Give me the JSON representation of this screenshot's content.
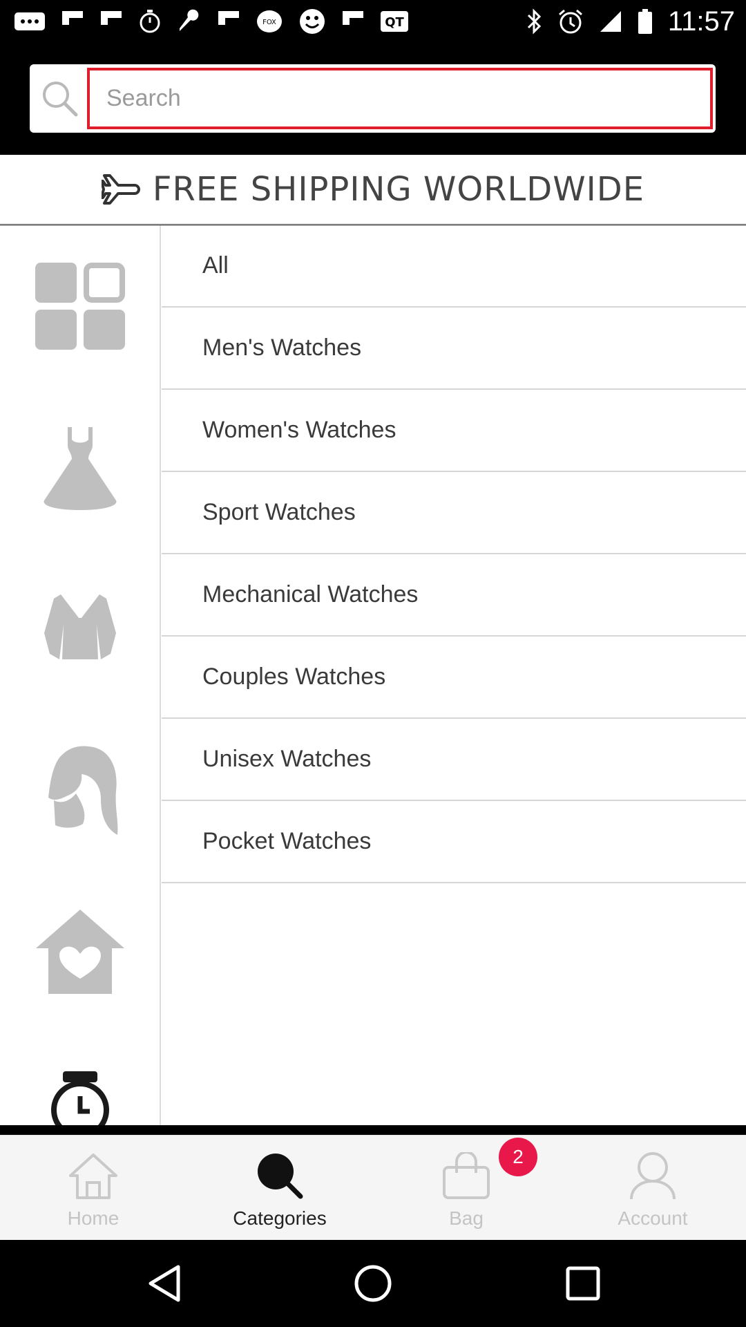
{
  "status_bar": {
    "time": "11:57",
    "icons": [
      "more-icon",
      "flipboard-icon",
      "flipboard-icon",
      "timer-icon",
      "wrench-icon",
      "flipboard-icon",
      "fox-sports-icon",
      "smiley-icon",
      "flipboard-icon",
      "qt-icon",
      "bluetooth-icon",
      "alarm-icon",
      "signal-icon",
      "battery-icon"
    ]
  },
  "search": {
    "placeholder": "Search"
  },
  "banner": {
    "text": "FREE SHIPPING WORLDWIDE",
    "icon": "airplane-icon"
  },
  "sidebar": {
    "icons": [
      "grid-icon",
      "dress-icon",
      "jacket-icon",
      "woman-hair-icon",
      "home-heart-icon",
      "watch-icon"
    ]
  },
  "categories": [
    {
      "label": "All"
    },
    {
      "label": "Men's Watches"
    },
    {
      "label": "Women's Watches"
    },
    {
      "label": "Sport Watches"
    },
    {
      "label": "Mechanical Watches"
    },
    {
      "label": "Couples Watches"
    },
    {
      "label": "Unisex Watches"
    },
    {
      "label": "Pocket Watches"
    }
  ],
  "bottom_nav": {
    "home": "Home",
    "categories": "Categories",
    "bag": "Bag",
    "account": "Account",
    "bag_count": "2",
    "active": "categories"
  },
  "colors": {
    "accent_red": "#e01e2b",
    "badge": "#e8194a",
    "icon_gray": "#c9c9c9",
    "active_dark": "#111111"
  }
}
